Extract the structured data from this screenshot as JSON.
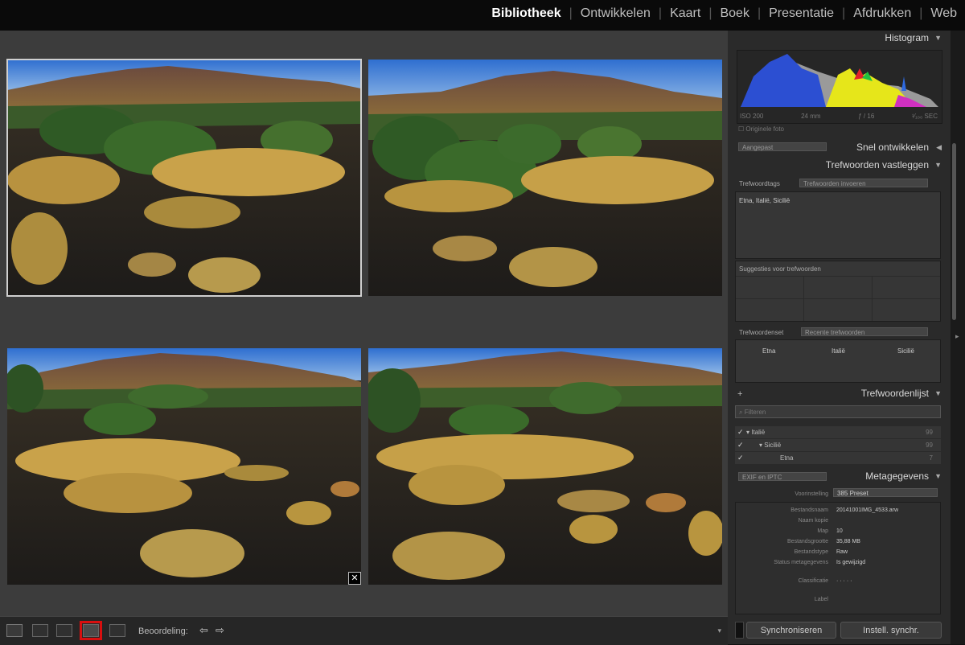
{
  "modules": [
    "Bibliotheek",
    "Ontwikkelen",
    "Kaart",
    "Boek",
    "Presentatie",
    "Afdrukken",
    "Web"
  ],
  "active_module": "Bibliotheek",
  "panels": {
    "histogram": "Histogram",
    "histogram_info": [
      "ISO 200",
      "24 mm",
      "ƒ / 16",
      "¹⁄₁₀₀ SEC"
    ],
    "original_photo": "Originele foto",
    "quick_develop_preset": "Aangepast",
    "quick_develop": "Snel ontwikkelen",
    "keywording": "Trefwoorden vastleggen",
    "keyword_tags_label": "Trefwoordtags",
    "keyword_tags_select": "Trefwoorden invoeren",
    "keyword_tags_value": "Etna, Italië, Sicilië",
    "suggestions": "Suggesties voor trefwoorden",
    "keyword_set_label": "Trefwoordenset",
    "keyword_set_select": "Recente trefwoorden",
    "keyword_set_items": [
      "Etna",
      "Italië",
      "Sicilië"
    ],
    "keyword_list_plus": "+",
    "keyword_list": "Trefwoordenlijst",
    "keyword_filter_placeholder": "Filteren",
    "keyword_tree": [
      {
        "name": "Italië",
        "count": "99"
      },
      {
        "name": "Sicilië",
        "count": "99"
      },
      {
        "name": "Etna",
        "count": "7"
      }
    ],
    "metadata_preset": "EXIF en IPTC",
    "metadata": "Metagegevens",
    "metadata_default_label": "Voorinstelling",
    "metadata_default": "385 Preset",
    "metadata_fields": [
      {
        "key": "Bestandsnaam",
        "value": "20141001IMG_4533.arw"
      },
      {
        "key": "Naam kopie",
        "value": ""
      },
      {
        "key": "Map",
        "value": "10"
      },
      {
        "key": "Bestandsgrootte",
        "value": "35,88 MB"
      },
      {
        "key": "Bestandstype",
        "value": "Raw"
      },
      {
        "key": "Status metagegevens",
        "value": "Is gewijzigd"
      },
      {
        "key": "Classificatie",
        "value": "· · · · ·"
      },
      {
        "key": "Label",
        "value": ""
      }
    ],
    "sync_button": "Synchroniseren",
    "sync_settings_button": "Instell. synchr."
  },
  "toolbar": {
    "rating_label": "Beoordeling:",
    "prev": "⇦",
    "next": "⇨",
    "menu": "▾",
    "close": "✕"
  },
  "colors": {
    "highlight": "#d80f0f",
    "bg": "#3c3c3c",
    "panel": "#2a2a2a"
  }
}
